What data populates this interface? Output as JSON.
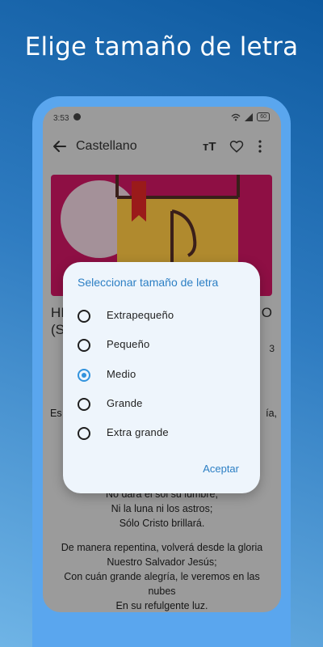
{
  "promo": {
    "title": "Elige tamaño de letra"
  },
  "status_bar": {
    "time": "3:53",
    "battery": "60"
  },
  "app_bar": {
    "title": "Castellano"
  },
  "song": {
    "title_line1": "HI",
    "title_line2": "(S",
    "title_tail": "O",
    "number_tail": "3"
  },
  "lyrics": {
    "partial_left": "Es",
    "partial_right": "ía,",
    "verse1": [
      "No dará el sol su lumbre,",
      "Ni la luna ni los astros;",
      "Sólo Cristo brillará."
    ],
    "verse2": [
      "De manera repentina, volverá desde la gloria",
      "Nuestro Salvador Jesús;",
      "Con cuán grande alegría, le veremos en las",
      "nubes",
      "En su refulgente luz."
    ]
  },
  "dialog": {
    "title": "Seleccionar tamaño de letra",
    "options": [
      {
        "label": "Extrapequeño",
        "selected": false
      },
      {
        "label": "Pequeño",
        "selected": false
      },
      {
        "label": "Medio",
        "selected": true
      },
      {
        "label": "Grande",
        "selected": false
      },
      {
        "label": "Extra grande",
        "selected": false
      }
    ],
    "accept_label": "Aceptar"
  },
  "colors": {
    "accent": "#3293dd",
    "dialog_bg": "#eef5fc",
    "hero_bg": "#8e0f44",
    "phone_frame": "#5aa6ee"
  },
  "icons": [
    "back-arrow-icon",
    "text-size-icon",
    "heart-icon",
    "more-vert-icon",
    "wifi-icon",
    "signal-icon",
    "battery-icon"
  ]
}
